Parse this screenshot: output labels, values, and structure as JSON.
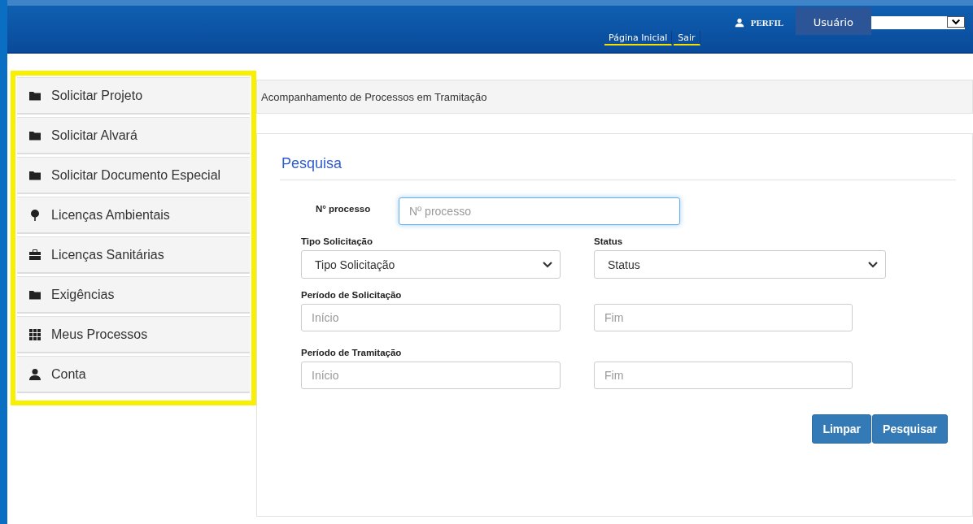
{
  "header": {
    "nav_links": [
      {
        "label": "Página Inicial"
      },
      {
        "label": "Sair"
      }
    ],
    "profile_label": "PERFIL",
    "profile_tooltip": "Usuário"
  },
  "sidebar": {
    "items": [
      {
        "label": "Solicitar Projeto",
        "kind": "folder"
      },
      {
        "label": "Solicitar Alvará",
        "kind": "folder"
      },
      {
        "label": "Solicitar Documento Especial",
        "kind": "folder"
      },
      {
        "label": "Licenças Ambientais",
        "kind": "tree"
      },
      {
        "label": "Licenças Sanitárias",
        "kind": "briefcase"
      },
      {
        "label": "Exigências",
        "kind": "folder"
      },
      {
        "label": "Meus Processos",
        "kind": "grid"
      },
      {
        "label": "Conta",
        "kind": "user"
      }
    ]
  },
  "page_title": "Acompanhamento de Processos em Tramitação",
  "search": {
    "heading": "Pesquisa",
    "process_field": {
      "label": "N° processo",
      "placeholder": "Nº processo",
      "focused": true
    },
    "type_select": {
      "label": "Tipo Solicitação",
      "value": "Tipo Solicitação"
    },
    "status_select": {
      "label": "Status",
      "value": "Status"
    },
    "request_period": {
      "label": "Período de Solicitação",
      "start_placeholder": "Início",
      "end_placeholder": "Fim"
    },
    "processing_period": {
      "label": "Período de Tramitação",
      "start_placeholder": "Início",
      "end_placeholder": "Fim"
    },
    "buttons": [
      "Limpar",
      "Pesquisar"
    ]
  }
}
